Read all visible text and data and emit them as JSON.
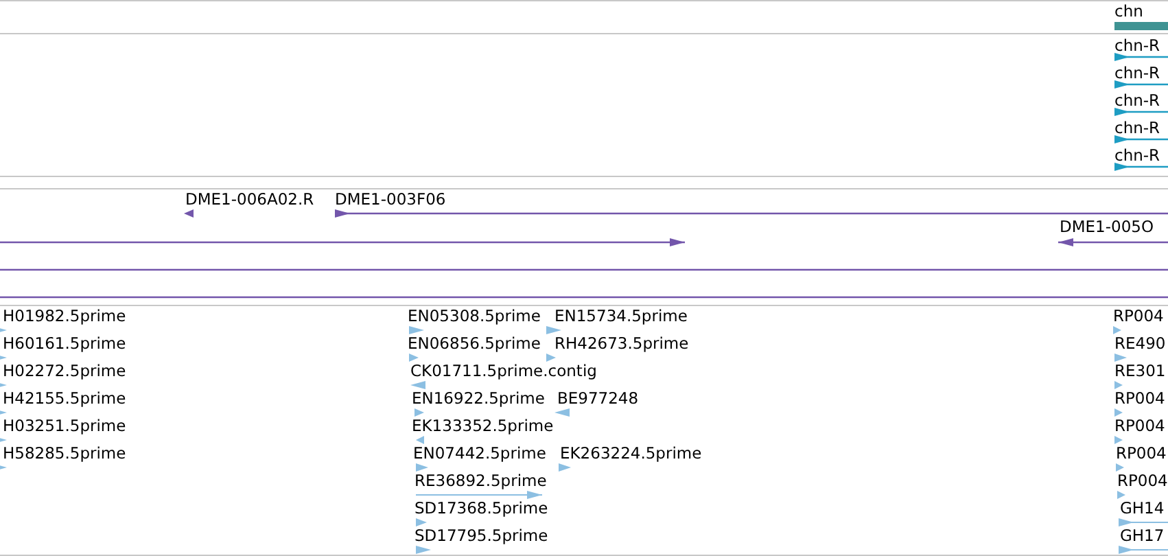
{
  "tracks": [
    {
      "kind": "gene",
      "features": [
        {
          "label": "chn",
          "kind": "plain"
        }
      ]
    },
    {
      "kind": "transcript",
      "features": [
        {
          "label": "chn-R",
          "kind": "forward"
        },
        {
          "label": "chn-R",
          "kind": "forward"
        },
        {
          "label": "chn-R",
          "kind": "forward"
        },
        {
          "label": "chn-R",
          "kind": "forward"
        },
        {
          "label": "chn-R",
          "kind": "forward"
        }
      ]
    },
    {
      "kind": "empty"
    },
    {
      "kind": "match",
      "features": [
        {
          "label": "DME1-006A02.R",
          "kind": "reverse"
        },
        {
          "label": "DME1-003F06",
          "kind": "forward"
        },
        {
          "kind": "forward"
        },
        {
          "label": "DME1-005O",
          "kind": "reverse"
        },
        {
          "kind": "plain"
        },
        {
          "kind": "plain"
        }
      ]
    },
    {
      "kind": "est",
      "features": [
        {
          "label": "H01982.5prime",
          "kind": "forward"
        },
        {
          "label": "H60161.5prime",
          "kind": "forward"
        },
        {
          "label": "H02272.5prime",
          "kind": "forward"
        },
        {
          "label": "H42155.5prime",
          "kind": "forward"
        },
        {
          "label": "H03251.5prime",
          "kind": "forward"
        },
        {
          "label": "H58285.5prime",
          "kind": "forward"
        },
        {
          "label": "EN05308.5prime",
          "kind": "forward"
        },
        {
          "label": "EN06856.5prime",
          "kind": "forward"
        },
        {
          "label": "CK01711.5prime.contig",
          "kind": "reverse"
        },
        {
          "label": "EN16922.5prime",
          "kind": "forward"
        },
        {
          "label": "EK133352.5prime",
          "kind": "reverse"
        },
        {
          "label": "EN07442.5prime",
          "kind": "forward"
        },
        {
          "label": "RE36892.5prime",
          "kind": "forward"
        },
        {
          "label": "SD17368.5prime",
          "kind": "forward"
        },
        {
          "label": "SD17795.5prime",
          "kind": "forward"
        },
        {
          "label": "EN15734.5prime",
          "kind": "forward"
        },
        {
          "label": "RH42673.5prime",
          "kind": "forward"
        },
        {
          "label": "BE977248",
          "kind": "reverse"
        },
        {
          "label": "EK263224.5prime",
          "kind": "forward"
        },
        {
          "label": "RP004",
          "kind": "forward"
        },
        {
          "label": "RE490",
          "kind": "forward"
        },
        {
          "label": "RE301",
          "kind": "forward"
        },
        {
          "label": "RP004",
          "kind": "forward"
        },
        {
          "label": "RP004",
          "kind": "forward"
        },
        {
          "label": "RP004",
          "kind": "forward"
        },
        {
          "label": "RP004",
          "kind": "forward"
        },
        {
          "label": "GH14",
          "kind": "forward"
        },
        {
          "label": "GH17",
          "kind": "forward"
        }
      ]
    }
  ]
}
